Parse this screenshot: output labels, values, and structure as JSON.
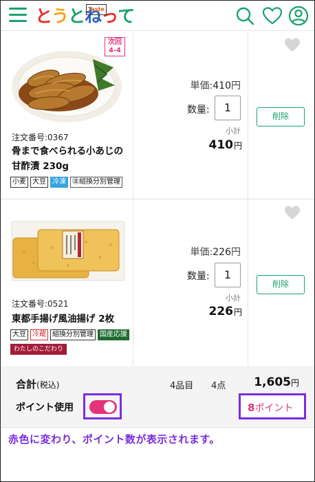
{
  "logo": {
    "chars": [
      {
        "t": "と",
        "c": "#e0322b"
      },
      {
        "t": "う",
        "c": "#f2a71a"
      },
      {
        "t": "と",
        "c": "#1aa26b"
      },
      {
        "t": "ね",
        "c": "#2f62c2"
      },
      {
        "t": "っ",
        "c": "#e0322b"
      },
      {
        "t": "て",
        "c": "#1aa26b"
      }
    ],
    "tag": "Taste"
  },
  "accent_color": "#1aa26b",
  "items": [
    {
      "next_badge_line1": "次回",
      "next_badge_line2": "4-4",
      "order_no": "注文番号:0367",
      "name": "骨まで食べられる小あじの甘酢漬 230g",
      "tags": [
        {
          "label": "小麦",
          "style": ""
        },
        {
          "label": "大豆",
          "style": ""
        },
        {
          "label": "冷凍",
          "style": "blue"
        },
        {
          "label": "㊟組換分別管理",
          "style": "circle"
        }
      ],
      "unit_label": "単価:",
      "unit_price": "410",
      "yen": "円",
      "qty_label": "数量:",
      "qty": "1",
      "subtotal_label": "小計",
      "subtotal": "410",
      "delete_label": "削除"
    },
    {
      "order_no": "注文番号:0521",
      "name": "東都手揚げ風油揚げ 2枚",
      "tags": [
        {
          "label": "大豆",
          "style": ""
        },
        {
          "label": "冷蔵",
          "style": "red"
        },
        {
          "label": "組換分別管理",
          "style": ""
        },
        {
          "label": "国産応援",
          "style": "green"
        },
        {
          "label": "わたしのこだわり",
          "style": "maroon"
        }
      ],
      "unit_label": "単価:",
      "unit_price": "226",
      "yen": "円",
      "qty_label": "数量:",
      "qty": "1",
      "subtotal_label": "小計",
      "subtotal": "226",
      "delete_label": "削除"
    }
  ],
  "summary": {
    "total_label": "合計",
    "tax_label": "(税込)",
    "item_count": "4品目",
    "piece_count": "4点",
    "total": "1,605",
    "yen": "円",
    "point_use_label": "ポイント使用",
    "toggle_on": true,
    "points_number": "8",
    "points_unit": "ポイント"
  },
  "caption": "赤色に変わり、ポイント数が表示されます。"
}
